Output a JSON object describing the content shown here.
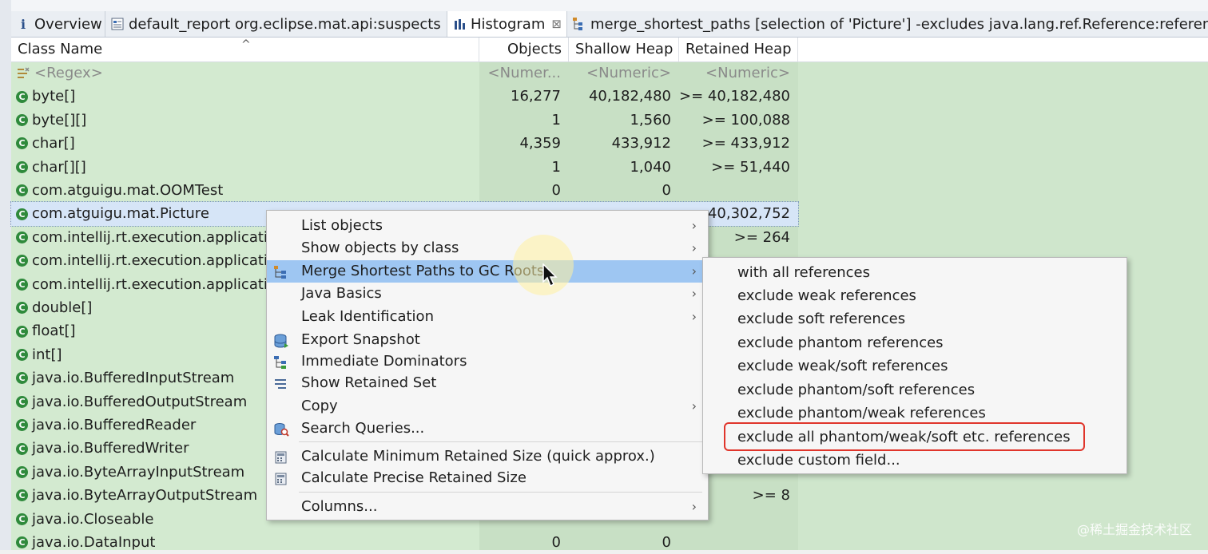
{
  "tabs": [
    {
      "label": "Overview",
      "icon": "info-icon",
      "active": false
    },
    {
      "label": "default_report  org.eclipse.mat.api:suspects",
      "icon": "report-icon",
      "active": false
    },
    {
      "label": "Histogram",
      "icon": "histogram-icon",
      "active": true,
      "close": "⊠"
    },
    {
      "label": "merge_shortest_paths  [selection of 'Picture'] -excludes java.lang.ref.Reference:referen",
      "icon": "tree-icon",
      "active": false
    }
  ],
  "columns": {
    "class_name": "Class Name",
    "objects": "Objects",
    "shallow_heap": "Shallow Heap",
    "retained_heap": "Retained Heap",
    "sort_caret": "^"
  },
  "filter_row": {
    "name": "<Regex>",
    "objects": "<Numer...",
    "shallow": "<Numeric>",
    "retained": "<Numeric>"
  },
  "rows": [
    {
      "name": "byte[]",
      "objects": "16,277",
      "shallow": "40,182,480",
      "retained": ">= 40,182,480"
    },
    {
      "name": "byte[][]",
      "objects": "1",
      "shallow": "1,560",
      "retained": ">= 100,088"
    },
    {
      "name": "char[]",
      "objects": "4,359",
      "shallow": "433,912",
      "retained": ">= 433,912"
    },
    {
      "name": "char[][]",
      "objects": "1",
      "shallow": "1,040",
      "retained": ">= 51,440"
    },
    {
      "name": "com.atguigu.mat.OOMTest",
      "objects": "0",
      "shallow": "0",
      "retained": ""
    },
    {
      "name": "com.atguigu.mat.Picture",
      "objects": "",
      "shallow": "",
      "retained": "40,302,752",
      "selected": true
    },
    {
      "name": "com.intellij.rt.execution.applicati",
      "objects": "",
      "shallow": "",
      "retained": ">= 264"
    },
    {
      "name": "com.intellij.rt.execution.applicati",
      "objects": "",
      "shallow": "",
      "retained": ""
    },
    {
      "name": "com.intellij.rt.execution.applicati",
      "objects": "",
      "shallow": "",
      "retained": ""
    },
    {
      "name": "double[]",
      "objects": "",
      "shallow": "",
      "retained": ""
    },
    {
      "name": "float[]",
      "objects": "",
      "shallow": "",
      "retained": ""
    },
    {
      "name": "int[]",
      "objects": "",
      "shallow": "",
      "retained": ""
    },
    {
      "name": "java.io.BufferedInputStream",
      "objects": "",
      "shallow": "",
      "retained": ""
    },
    {
      "name": "java.io.BufferedOutputStream",
      "objects": "",
      "shallow": "",
      "retained": ""
    },
    {
      "name": "java.io.BufferedReader",
      "objects": "",
      "shallow": "",
      "retained": ""
    },
    {
      "name": "java.io.BufferedWriter",
      "objects": "",
      "shallow": "",
      "retained": ""
    },
    {
      "name": "java.io.ByteArrayInputStream",
      "objects": "",
      "shallow": "",
      "retained": ""
    },
    {
      "name": "java.io.ByteArrayOutputStream",
      "objects": "",
      "shallow": "",
      "retained": ">= 8"
    },
    {
      "name": "java.io.Closeable",
      "objects": "",
      "shallow": "",
      "retained": ""
    },
    {
      "name": "java.io.DataInput",
      "objects": "0",
      "shallow": "0",
      "retained": ""
    }
  ],
  "context_menu": {
    "items": [
      {
        "label": "List objects",
        "submenu": true
      },
      {
        "label": "Show objects by class",
        "submenu": true
      },
      {
        "label": "Merge Shortest Paths to GC Roots",
        "submenu": true,
        "highlighted": true,
        "icon": "paths-icon"
      },
      {
        "label": "Java Basics",
        "submenu": true
      },
      {
        "label": "Leak Identification",
        "submenu": true
      },
      {
        "label": "Export Snapshot",
        "icon": "database-icon"
      },
      {
        "label": "Immediate Dominators",
        "icon": "dominator-tree-icon"
      },
      {
        "label": "Show Retained Set",
        "icon": "list-icon"
      },
      {
        "label": "Copy",
        "submenu": true
      },
      {
        "label": "Search Queries...",
        "icon": "search-queries-icon"
      },
      {
        "label": "Calculate Minimum Retained Size (quick approx.)",
        "icon": "calculator-icon"
      },
      {
        "label": "Calculate Precise Retained Size",
        "icon": "calculator-icon"
      },
      {
        "label": "Columns...",
        "submenu": true
      }
    ],
    "arrow": "›"
  },
  "submenu": {
    "items": [
      "with all references",
      "exclude weak references",
      "exclude soft references",
      "exclude phantom references",
      "exclude weak/soft references",
      "exclude phantom/soft references",
      "exclude phantom/weak references",
      "exclude all phantom/weak/soft etc. references",
      "exclude custom field..."
    ]
  },
  "watermark": "@稀土掘金技术社区",
  "colors": {
    "row_bg": "#d3ead0",
    "menu_highlight": "#9ec6f2",
    "annotation_box": "#e0352b",
    "class_icon": "#2f8a3c"
  }
}
